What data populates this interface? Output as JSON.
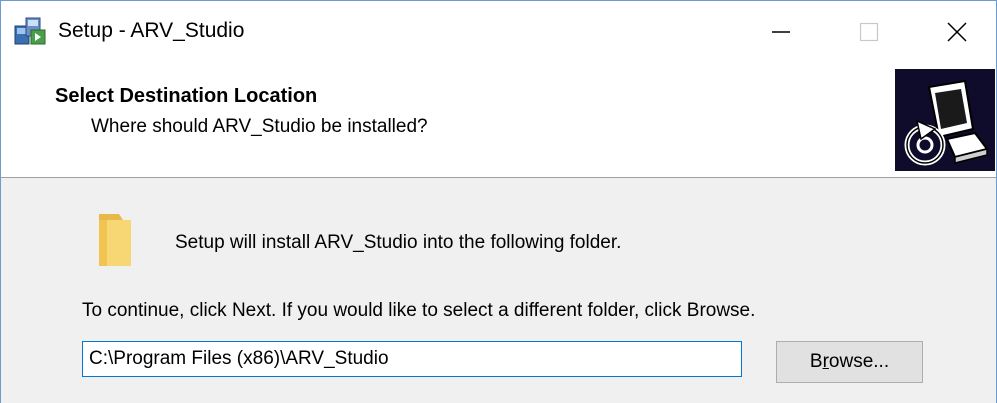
{
  "window": {
    "title": "Setup - ARV_Studio"
  },
  "titlebar": {
    "minimize_icon": "minimize-icon",
    "maximize_icon": "maximize-icon",
    "close_icon": "close-icon"
  },
  "header": {
    "title": "Select Destination Location",
    "subtitle": "Where should ARV_Studio be installed?"
  },
  "body": {
    "install_message": "Setup will install ARV_Studio into the following folder.",
    "continue_message": "To continue, click Next. If you would like to select a different folder, click Browse.",
    "path_value": "C:\\Program Files (x86)\\ARV_Studio",
    "browse_label_pre": "B",
    "browse_label_accel": "r",
    "browse_label_post": "owse..."
  },
  "colors": {
    "accent": "#0078d7",
    "body_bg": "#f0f0f0",
    "wizard_bg": "#0e0c2a"
  }
}
